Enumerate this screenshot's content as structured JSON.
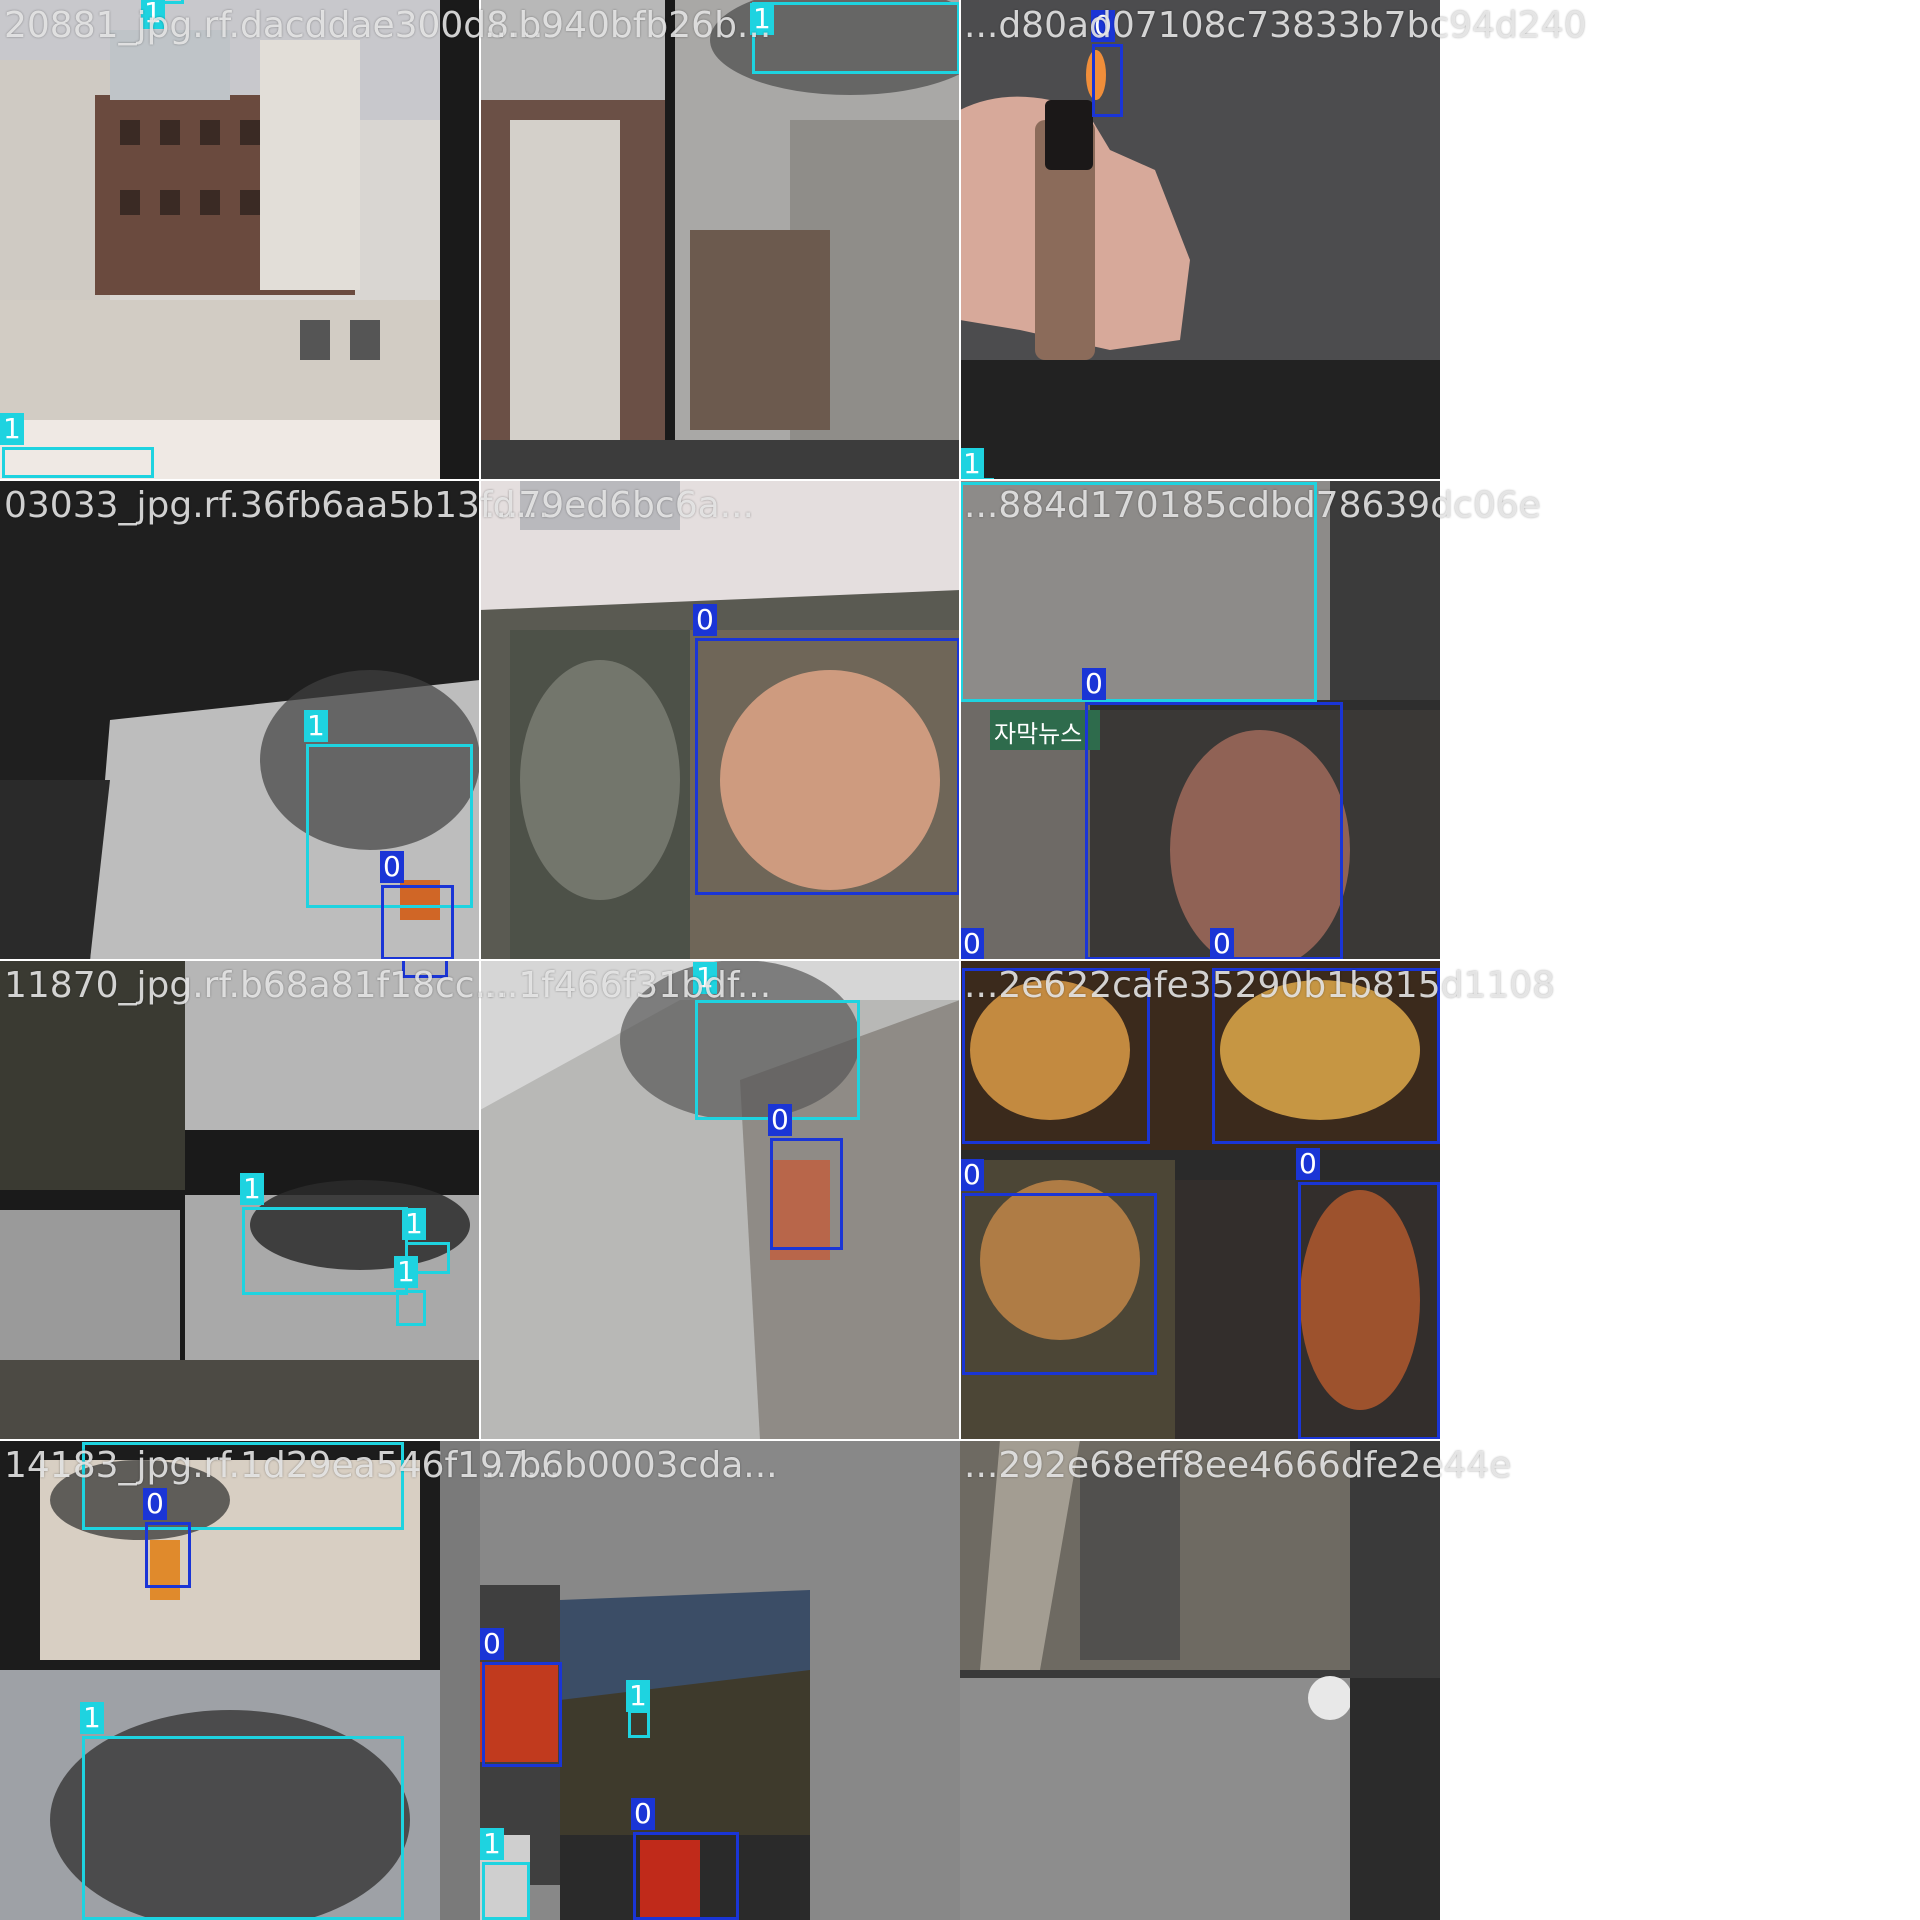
{
  "canvas": {
    "background": "#ffffff"
  },
  "colors": {
    "class_0": "#1a35d6",
    "class_1": "#1ed3e0",
    "filename_text": "#ebebeb"
  },
  "tiles": [
    {
      "filename": "20881_jpg.rf.dacddae300d8..."
    },
    {
      "filename": "...b940bfb26b..."
    },
    {
      "filename": "...d80ad07108c73833b7bc94d240"
    },
    {
      "filename": "03033_jpg.rf.36fb6aa5b13fd..."
    },
    {
      "filename": "...79ed6bc6a..."
    },
    {
      "filename": "...884d170185cdbd78639dc06e"
    },
    {
      "filename": "11870_jpg.rf.b68a81f18cc..."
    },
    {
      "filename": "...1f466f31bdf..."
    },
    {
      "filename": "...2e622cafe35290b1b815d1108"
    },
    {
      "filename": "14183_jpg.rf.1d29ea546f197..."
    },
    {
      "filename": "...b6b0003cda..."
    },
    {
      "filename": "...292e68eff8ee4666dfe2e44e"
    }
  ],
  "labels": {
    "class_0": "0",
    "class_1": "1"
  },
  "scene_text": {
    "korean_banner": "자막뉴스"
  }
}
